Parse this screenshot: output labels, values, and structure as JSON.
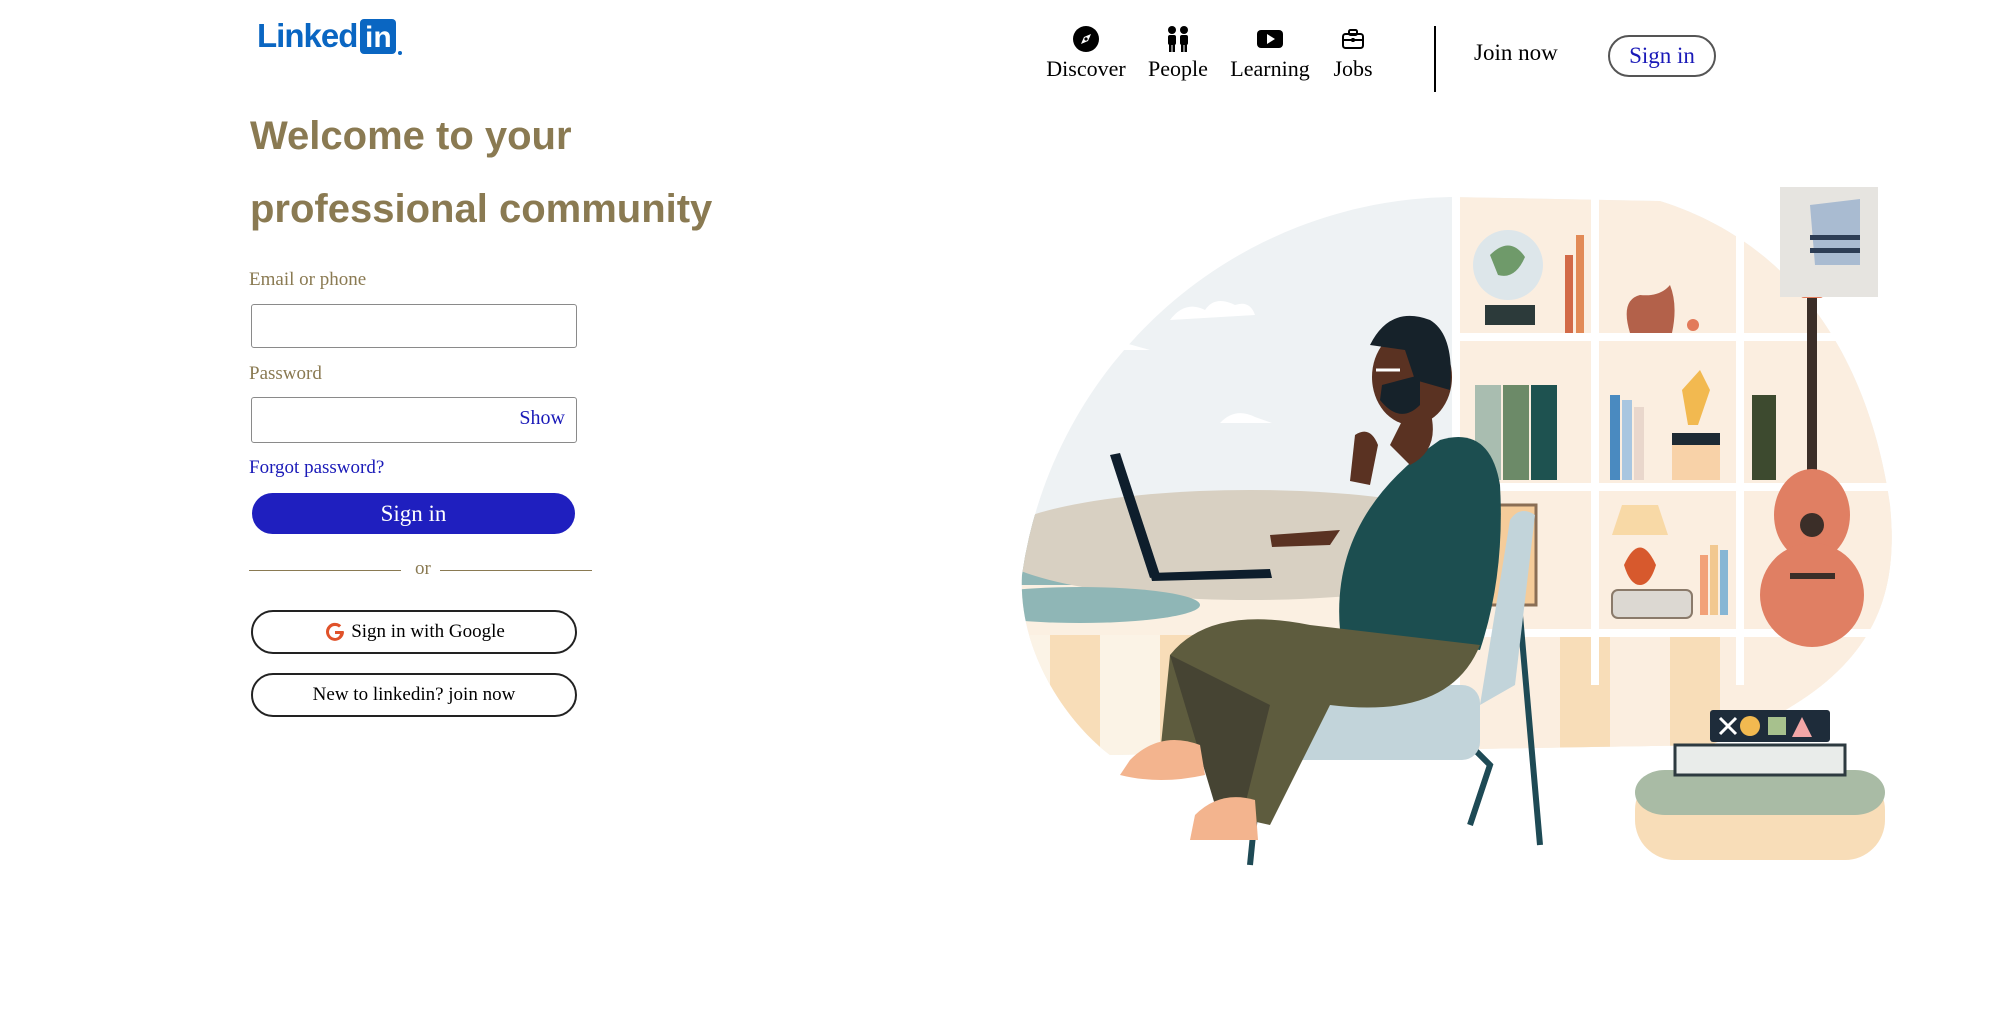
{
  "header": {
    "logo_word": "Linked",
    "logo_box": "in",
    "nav": [
      {
        "label": "Discover",
        "icon": "compass-icon"
      },
      {
        "label": "People",
        "icon": "people-icon"
      },
      {
        "label": "Learning",
        "icon": "play-icon"
      },
      {
        "label": "Jobs",
        "icon": "briefcase-icon"
      }
    ],
    "join_now": "Join now",
    "sign_in": "Sign in"
  },
  "hero": {
    "headline_line1": "Welcome to your",
    "headline_line2": "professional community"
  },
  "form": {
    "email_label": "Email or phone",
    "email_value": "",
    "password_label": "Password",
    "password_value": "",
    "show_label": "Show",
    "forgot_label": "Forgot password?",
    "sign_in_label": "Sign in",
    "or_label": "or",
    "google_label": "Sign in with Google",
    "join_label": "New to linkedin? join now"
  },
  "colors": {
    "brand": "#0a66c2",
    "headline": "#8a7a52",
    "primary_button": "#1f1fbf",
    "link": "#1a1ab8"
  }
}
